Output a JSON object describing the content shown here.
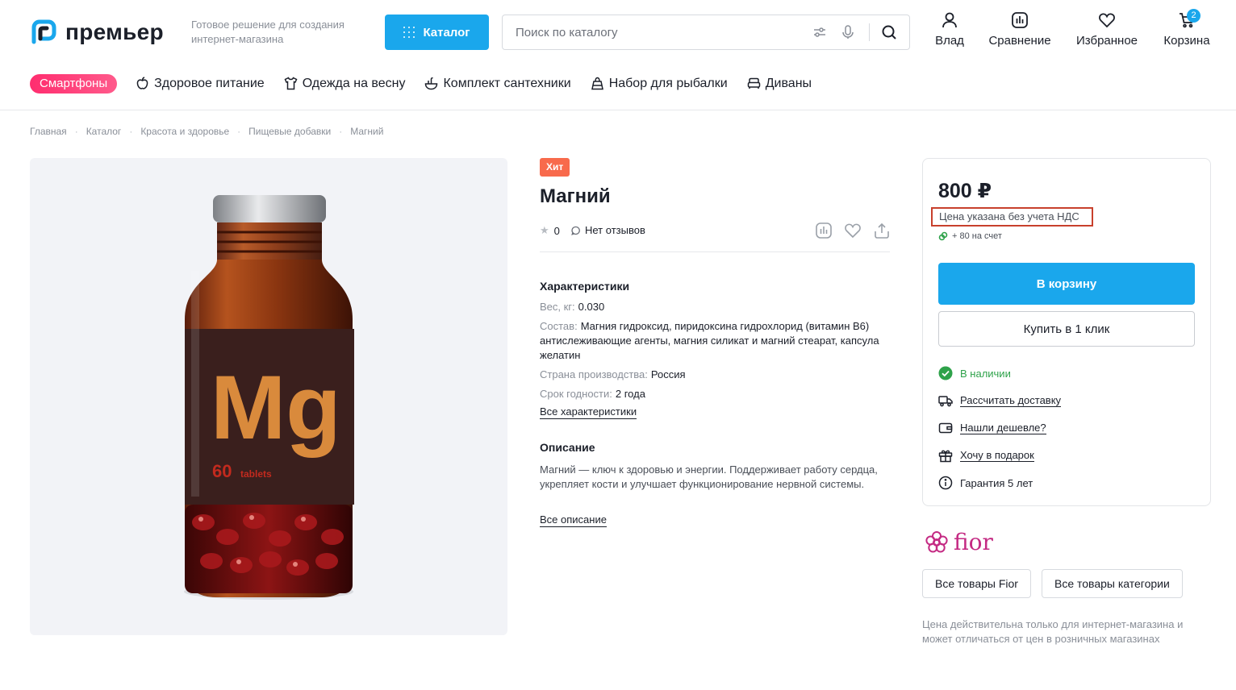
{
  "header": {
    "logo_text": "премьер",
    "tagline": "Готовое решение для создания интернет-магазина",
    "catalog_label": "Каталог",
    "search_placeholder": "Поиск по каталогу",
    "user_label": "Влад",
    "compare_label": "Сравнение",
    "favorites_label": "Избранное",
    "cart_label": "Корзина",
    "cart_count": "2"
  },
  "nav": {
    "promo": "Смартфоны",
    "items": [
      {
        "label": "Здоровое питание",
        "icon": "apple-icon"
      },
      {
        "label": "Одежда на весну",
        "icon": "shirt-icon"
      },
      {
        "label": "Комплект сантехники",
        "icon": "faucet-icon"
      },
      {
        "label": "Набор для рыбалки",
        "icon": "bag-icon"
      },
      {
        "label": "Диваны",
        "icon": "sofa-icon"
      }
    ]
  },
  "breadcrumb": [
    "Главная",
    "Каталог",
    "Красота и здоровье",
    "Пищевые добавки",
    "Магний"
  ],
  "product": {
    "badge": "Хит",
    "title": "Магний",
    "rating": "0",
    "reviews": "Нет отзывов",
    "image_label": "Mg",
    "image_sub_number": "60",
    "image_sub_text": "tablets"
  },
  "specs": {
    "heading": "Характеристики",
    "rows": [
      {
        "key": "Вес, кг:",
        "value": "0.030"
      },
      {
        "key": "Состав:",
        "value": "Магния гидроксид, пиридоксина гидрохлорид (витамин В6) антислеживающие агенты, магния силикат и магний стеарат, капсула желатин"
      },
      {
        "key": "Страна производства:",
        "value": "Россия"
      },
      {
        "key": "Срок годности:",
        "value": "2 года"
      }
    ],
    "all_link": "Все характеристики"
  },
  "description": {
    "heading": "Описание",
    "text": "Магний — ключ к здоровью и энергии. Поддерживает работу сердца, укрепляет кости и улучшает функционирование нервной системы.",
    "all_link": "Все описание"
  },
  "buybox": {
    "price": "800 ₽",
    "vat_note": "Цена указана без учета НДС",
    "bonus": "+ 80 на счет",
    "add_to_cart": "В корзину",
    "one_click": "Купить в 1 клик",
    "options": {
      "stock": "В наличии",
      "delivery": "Рассчитать доставку",
      "cheaper": "Нашли дешевле?",
      "gift": "Хочу в подарок",
      "warranty": "Гарантия 5 лет"
    }
  },
  "brand": {
    "name": "fior",
    "all_brand": "Все товары Fior",
    "all_category": "Все товары категории"
  },
  "footer_note": "Цена действительна только для интернет-магазина и может отличаться от цен в розничных магазинах",
  "colors": {
    "accent": "#1aa7ec",
    "promo": "#ff2d6f",
    "badge": "#f86a4c",
    "in_stock": "#2ea24a",
    "brand": "#c42a83",
    "highlight_border": "#c8402c"
  }
}
